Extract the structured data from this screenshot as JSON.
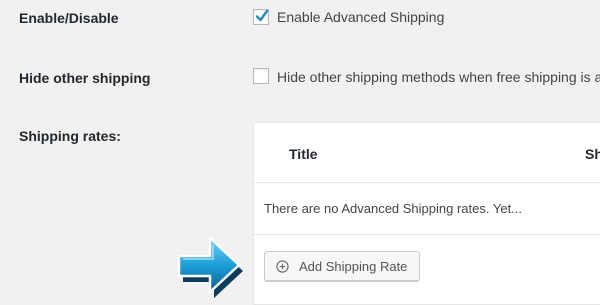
{
  "settings": {
    "enable": {
      "label": "Enable/Disable",
      "checkbox_text": "Enable Advanced Shipping",
      "checked": true
    },
    "hide_other": {
      "label": "Hide other shipping",
      "checkbox_text": "Hide other shipping methods when free shipping is a",
      "checked": false
    },
    "rates": {
      "label": "Shipping rates:",
      "columns": [
        "Title",
        "Sh"
      ],
      "empty_message": "There are no Advanced Shipping rates. Yet...",
      "add_button_label": "Add Shipping Rate",
      "add_button_icon": "plus-circle-icon"
    }
  },
  "annotation": {
    "arrow_icon": "right-arrow-icon",
    "arrow_color": "#1e9fd8"
  },
  "colors": {
    "background": "#f1f1f1",
    "checkmark": "#1e8cbe"
  }
}
